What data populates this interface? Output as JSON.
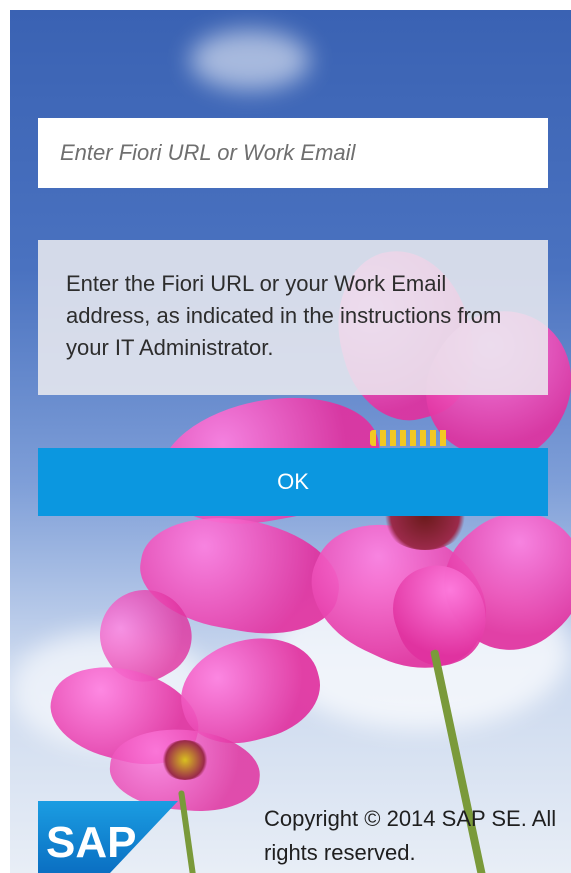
{
  "login": {
    "url_placeholder": "Enter Fiori URL or Work Email",
    "url_value": ""
  },
  "info": {
    "text": "Enter the Fiori URL or your Work Email address, as indicated in the instructions from your IT Administrator."
  },
  "actions": {
    "ok_label": "OK"
  },
  "footer": {
    "logo_text": "SAP",
    "copyright": "Copyright © 2014 SAP SE. All rights reserved."
  },
  "colors": {
    "accent": "#0b97e0",
    "sky": "#3a62b3",
    "petal": "#e0319f"
  }
}
